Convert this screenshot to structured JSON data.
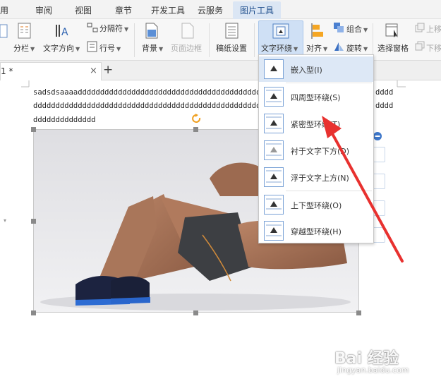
{
  "menu": {
    "items": [
      "用",
      "审阅",
      "视图",
      "章节",
      "开发工具",
      "云服务"
    ],
    "active": "图片工具"
  },
  "ribbon": {
    "fenlan": "分栏",
    "wenzifangxiang": "文字方向",
    "hanghao": "行号",
    "fengefu": "分隔符",
    "beijing": "背景",
    "yemianbiankuang": "页面边框",
    "gaozhi": "稿纸设置",
    "wenzihuanrao": "文字环绕",
    "duiqi": "对齐",
    "zuhe": "组合",
    "xuanzhuan": "旋转",
    "xuanzechuangge": "选择窗格",
    "shangyi": "上移",
    "xiayi": "下移"
  },
  "tab": {
    "label": "1 *",
    "close": "×",
    "add": "+"
  },
  "document": {
    "line1": "sadsdsaaaadddddddddddddddddddddddddddddddddddddddddddddddddd",
    "line2": "dddddddddddddddddddddddddddddddddddddddddddddddddddddddddddd",
    "line3": "dddddddddddddd",
    "line1_tail": "dddd",
    "line2_tail": "dddd"
  },
  "dropdown": {
    "items": [
      "嵌入型(I)",
      "四周型环绕(S)",
      "紧密型环绕(T)",
      "衬于文字下方(D)",
      "浮于文字上方(N)",
      "上下型环绕(O)",
      "穿越型环绕(H)"
    ]
  },
  "watermark": {
    "logo": "Bai 经验",
    "url": "jingyan.baidu.com"
  },
  "colors": {
    "accent": "#1f4e8c",
    "highlight": "#cfe0f5",
    "arrow": "#e8312f"
  }
}
